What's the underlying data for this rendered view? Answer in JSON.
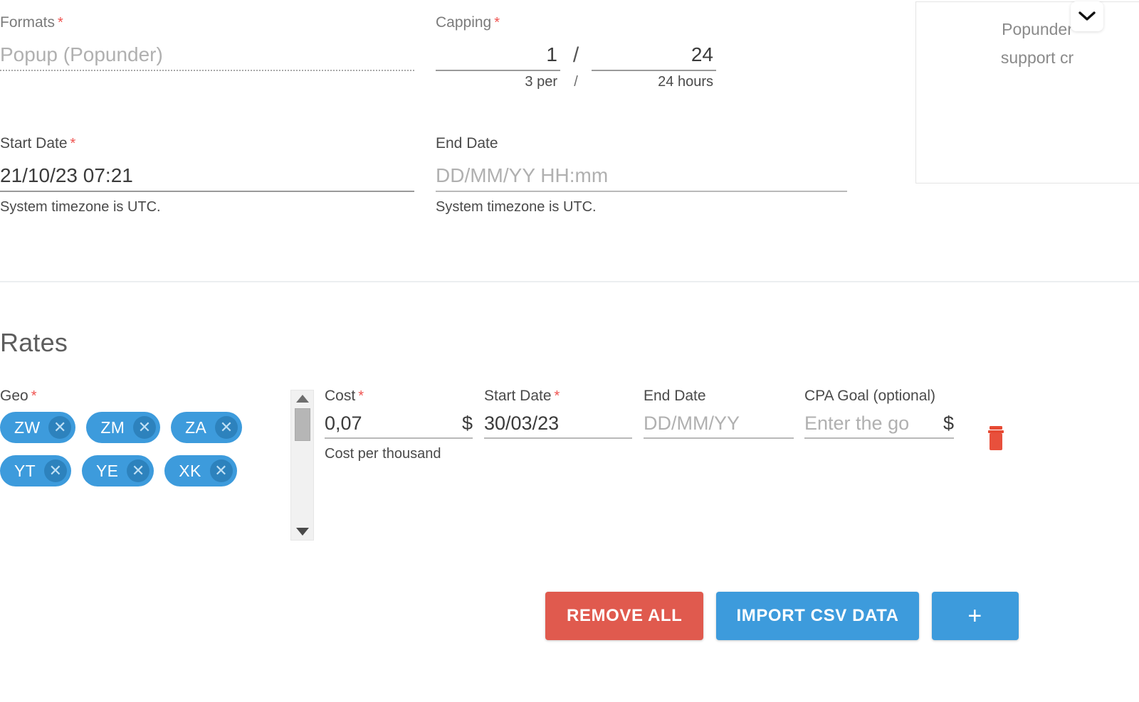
{
  "formats": {
    "label": "Formats",
    "required": true,
    "value": "",
    "placeholder": "Popup (Popunder)"
  },
  "capping": {
    "label": "Capping",
    "required": true,
    "count_value": "1",
    "count_hint": "3 per",
    "separator": "/",
    "hint_separator": "/",
    "period_value": "24",
    "period_hint": "24 hours"
  },
  "start_date": {
    "label": "Start Date",
    "required": true,
    "value": "21/10/23 07:21",
    "placeholder": "DD/MM/YY HH:mm",
    "hint": "System timezone is UTC."
  },
  "end_date": {
    "label": "End Date",
    "required": false,
    "value": "",
    "placeholder": "DD/MM/YY HH:mm",
    "hint": "System timezone is UTC."
  },
  "right_panel": {
    "line1": "Popunder",
    "line2": "support cr",
    "collapse_icon": "chevron-down-icon"
  },
  "rates": {
    "title": "Rates",
    "geo": {
      "label": "Geo",
      "required": true,
      "chips": [
        {
          "code": "ZW",
          "remove_icon": "close-circle-icon"
        },
        {
          "code": "ZM",
          "remove_icon": "close-circle-icon"
        },
        {
          "code": "ZA",
          "remove_icon": "close-circle-icon"
        },
        {
          "code": "YT",
          "remove_icon": "close-circle-icon"
        },
        {
          "code": "YE",
          "remove_icon": "close-circle-icon"
        },
        {
          "code": "XK",
          "remove_icon": "close-circle-icon"
        }
      ],
      "scrollbar": {
        "up_icon": "caret-up-icon",
        "down_icon": "caret-down-icon"
      }
    },
    "row": {
      "cost": {
        "label": "Cost",
        "required": true,
        "value": "0,07",
        "suffix": "$",
        "hint": "Cost per thousand"
      },
      "start_date": {
        "label": "Start Date",
        "required": true,
        "value": "30/03/23",
        "placeholder": "DD/MM/YY"
      },
      "end_date": {
        "label": "End Date",
        "required": false,
        "value": "",
        "placeholder": "DD/MM/YY"
      },
      "cpa_goal": {
        "label": "CPA Goal (optional)",
        "required": false,
        "value": "",
        "placeholder": "Enter the go",
        "suffix": "$"
      },
      "delete_icon": "trash-icon"
    },
    "actions": {
      "remove_all": "REMOVE ALL",
      "import_csv": "IMPORT CSV DATA",
      "add": "+"
    }
  },
  "colors": {
    "accent_blue": "#3d9bdc",
    "danger_red": "#e05a4e",
    "required_star": "#ef5350",
    "text": "#3b3b3b",
    "muted_text": "#7b7b7b",
    "placeholder": "#b0b0b0"
  }
}
